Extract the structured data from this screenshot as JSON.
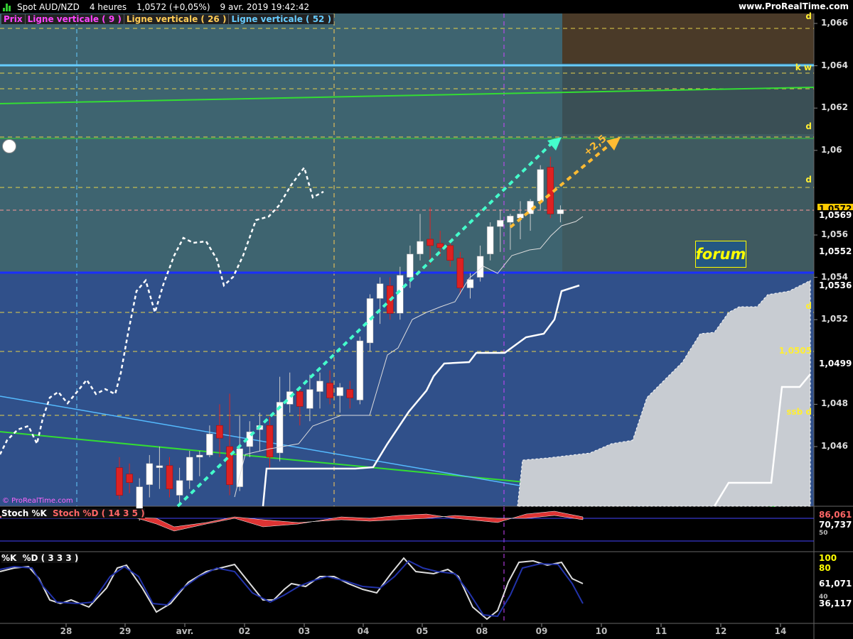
{
  "titlebar": {
    "symbol": "Spot AUD/NZD",
    "timeframe": "4 heures",
    "last_change": "1,0572 (+0,05%)",
    "datetime": "9 avr. 2019 19:42:42",
    "site": "www.ProRealTime.com"
  },
  "legend": [
    {
      "label": "Prix",
      "color": "#ff44ff"
    },
    {
      "label": "Ligne verticale ( 9 )",
      "color": "#ff44ff"
    },
    {
      "label": "Ligne verticale ( 26 )",
      "color": "#ffcc55"
    },
    {
      "label": "Ligne verticale ( 52 )",
      "color": "#66ccff"
    }
  ],
  "price_axis": [
    {
      "label": "1,066",
      "y": 1.066
    },
    {
      "label": "1,064",
      "y": 1.064
    },
    {
      "label": "1,062",
      "y": 1.062
    },
    {
      "label": "1,06",
      "y": 1.06
    },
    {
      "label": "1,056",
      "y": 1.056
    },
    {
      "label": "1,054",
      "y": 1.054
    },
    {
      "label": "1,052",
      "y": 1.052
    },
    {
      "label": "1,048",
      "y": 1.048
    },
    {
      "label": "1,046",
      "y": 1.046
    }
  ],
  "price_tags": [
    {
      "label": "1,0572",
      "y": 1.0572,
      "bg": "#ffcc00",
      "fg": "#000"
    },
    {
      "label": "1,0569",
      "y": 1.0569,
      "bg": "#000",
      "fg": "#fff"
    },
    {
      "label": "1,0552",
      "y": 1.0552,
      "bg": "#000",
      "fg": "#fff"
    },
    {
      "label": "1,0536",
      "y": 1.0536,
      "bg": "#000",
      "fg": "#fff"
    },
    {
      "label": "1,0499",
      "y": 1.0499,
      "bg": "#000",
      "fg": "#fff"
    }
  ],
  "level_labels": [
    {
      "label": "d",
      "y": 1.0663
    },
    {
      "label": "k w",
      "y": 1.0639
    },
    {
      "label": "d",
      "y": 1.0611
    },
    {
      "label": "d",
      "y": 1.0586
    },
    {
      "label": "d",
      "y": 1.0526
    },
    {
      "label": "1,0505",
      "y": 1.0505
    },
    {
      "label": "ssb d",
      "y": 1.0476
    }
  ],
  "annotation": "+2,5",
  "forum_label": "forum",
  "watermark": "© ProRealTime.com",
  "stoch1": {
    "legend_k": "Stoch %K",
    "legend_d": "Stoch %D ( 14 3 5 )",
    "value_k": "86,061",
    "value_d": "70,737",
    "partial": "50"
  },
  "stoch2": {
    "legend_k": "%K",
    "legend_d": "%D ( 3 3 3 )",
    "ticks": [
      "100",
      "80"
    ],
    "value_k": "61,071",
    "value_d": "36,117",
    "partial": "40"
  },
  "x_axis": [
    "28",
    "29",
    "avr.",
    "02",
    "03",
    "04",
    "05",
    "08",
    "09",
    "10",
    "11",
    "12",
    "14"
  ],
  "chart_data": {
    "type": "candlestick",
    "price_range": [
      1.044,
      1.0668
    ],
    "candles": [
      {
        "o": 1.045,
        "h": 1.0455,
        "l": 1.0435,
        "c": 1.0437
      },
      {
        "o": 1.0447,
        "h": 1.0452,
        "l": 1.0438,
        "c": 1.0443
      },
      {
        "o": 1.043,
        "h": 1.0445,
        "l": 1.0425,
        "c": 1.0441
      },
      {
        "o": 1.0442,
        "h": 1.0456,
        "l": 1.0436,
        "c": 1.0452
      },
      {
        "o": 1.045,
        "h": 1.046,
        "l": 1.044,
        "c": 1.0451
      },
      {
        "o": 1.0451,
        "h": 1.0455,
        "l": 1.0436,
        "c": 1.044
      },
      {
        "o": 1.0437,
        "h": 1.045,
        "l": 1.0432,
        "c": 1.0444
      },
      {
        "o": 1.0444,
        "h": 1.0458,
        "l": 1.044,
        "c": 1.0455
      },
      {
        "o": 1.0455,
        "h": 1.0458,
        "l": 1.0446,
        "c": 1.0456
      },
      {
        "o": 1.0456,
        "h": 1.047,
        "l": 1.0455,
        "c": 1.0466
      },
      {
        "o": 1.047,
        "h": 1.048,
        "l": 1.0455,
        "c": 1.0464
      },
      {
        "o": 1.046,
        "h": 1.0485,
        "l": 1.0437,
        "c": 1.0442
      },
      {
        "o": 1.0441,
        "h": 1.0475,
        "l": 1.0439,
        "c": 1.0459
      },
      {
        "o": 1.046,
        "h": 1.0472,
        "l": 1.0455,
        "c": 1.0467
      },
      {
        "o": 1.0468,
        "h": 1.0476,
        "l": 1.0458,
        "c": 1.047
      },
      {
        "o": 1.047,
        "h": 1.0474,
        "l": 1.045,
        "c": 1.0455
      },
      {
        "o": 1.0457,
        "h": 1.0493,
        "l": 1.0453,
        "c": 1.0481
      },
      {
        "o": 1.048,
        "h": 1.0495,
        "l": 1.0476,
        "c": 1.0486
      },
      {
        "o": 1.0486,
        "h": 1.0488,
        "l": 1.047,
        "c": 1.0479
      },
      {
        "o": 1.0478,
        "h": 1.0494,
        "l": 1.0472,
        "c": 1.0487
      },
      {
        "o": 1.0486,
        "h": 1.0495,
        "l": 1.0478,
        "c": 1.0491
      },
      {
        "o": 1.049,
        "h": 1.0496,
        "l": 1.048,
        "c": 1.0483
      },
      {
        "o": 1.0484,
        "h": 1.049,
        "l": 1.0476,
        "c": 1.0488
      },
      {
        "o": 1.0487,
        "h": 1.0491,
        "l": 1.0478,
        "c": 1.0483
      },
      {
        "o": 1.0482,
        "h": 1.0512,
        "l": 1.048,
        "c": 1.051
      },
      {
        "o": 1.0509,
        "h": 1.0532,
        "l": 1.0505,
        "c": 1.053
      },
      {
        "o": 1.053,
        "h": 1.054,
        "l": 1.0518,
        "c": 1.0537
      },
      {
        "o": 1.0536,
        "h": 1.054,
        "l": 1.052,
        "c": 1.0523
      },
      {
        "o": 1.0523,
        "h": 1.0545,
        "l": 1.052,
        "c": 1.0541
      },
      {
        "o": 1.054,
        "h": 1.0555,
        "l": 1.0535,
        "c": 1.0551
      },
      {
        "o": 1.0551,
        "h": 1.057,
        "l": 1.0548,
        "c": 1.0557
      },
      {
        "o": 1.0558,
        "h": 1.0573,
        "l": 1.0546,
        "c": 1.0555
      },
      {
        "o": 1.0556,
        "h": 1.0562,
        "l": 1.055,
        "c": 1.0554
      },
      {
        "o": 1.0555,
        "h": 1.0558,
        "l": 1.0545,
        "c": 1.0548
      },
      {
        "o": 1.0549,
        "h": 1.0552,
        "l": 1.0532,
        "c": 1.0535
      },
      {
        "o": 1.0535,
        "h": 1.0542,
        "l": 1.053,
        "c": 1.0539
      },
      {
        "o": 1.054,
        "h": 1.0555,
        "l": 1.0538,
        "c": 1.055
      },
      {
        "o": 1.0551,
        "h": 1.0566,
        "l": 1.0548,
        "c": 1.0564
      },
      {
        "o": 1.0564,
        "h": 1.0572,
        "l": 1.0552,
        "c": 1.0567
      },
      {
        "o": 1.0566,
        "h": 1.057,
        "l": 1.0553,
        "c": 1.0569
      },
      {
        "o": 1.0568,
        "h": 1.0576,
        "l": 1.0558,
        "c": 1.057
      },
      {
        "o": 1.057,
        "h": 1.0577,
        "l": 1.0562,
        "c": 1.0576
      },
      {
        "o": 1.0576,
        "h": 1.0593,
        "l": 1.0572,
        "c": 1.0591
      },
      {
        "o": 1.0592,
        "h": 1.0597,
        "l": 1.0568,
        "c": 1.057
      },
      {
        "o": 1.057,
        "h": 1.0574,
        "l": 1.0566,
        "c": 1.0572
      }
    ]
  }
}
